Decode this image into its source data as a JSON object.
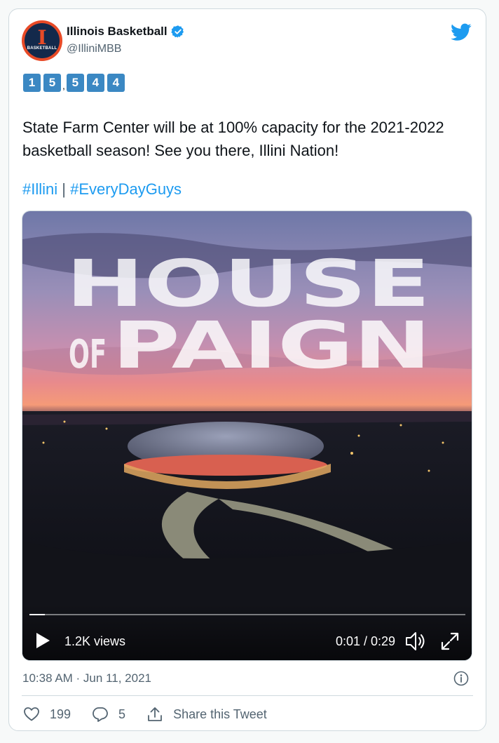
{
  "account": {
    "name": "Illinois Basketball",
    "handle": "@IlliniMBB",
    "avatar_letter": "I",
    "avatar_text": "BASKETBALL"
  },
  "keycaps": [
    "1",
    "5",
    "5",
    "4",
    "4"
  ],
  "keycap_separator": ",",
  "tweet": {
    "text": "State Farm Center will be at 100% capacity for the 2021-2022 basketball season! See you there, Illini Nation!",
    "hashtags": [
      "#Illini",
      "#EveryDayGuys"
    ],
    "hashtag_separator": "|"
  },
  "video": {
    "overlay_line1": "HOUSE",
    "overlay_of": "OF",
    "overlay_line2": "PAIGN",
    "views": "1.2K views",
    "time": "0:01 / 0:29",
    "progress": 0.035
  },
  "meta": {
    "timestamp": "10:38 AM · Jun 11, 2021"
  },
  "actions": {
    "likes": "199",
    "replies": "5",
    "share_label": "Share this Tweet"
  },
  "colors": {
    "accent": "#1d9bf0",
    "keycap": "#3b88c3",
    "illini_orange": "#e84a27",
    "illini_blue": "#13294b"
  },
  "icons": [
    "twitter-bird-icon",
    "verified-badge-icon",
    "play-icon",
    "volume-icon",
    "fullscreen-icon",
    "info-icon",
    "heart-icon",
    "reply-icon",
    "share-icon"
  ]
}
